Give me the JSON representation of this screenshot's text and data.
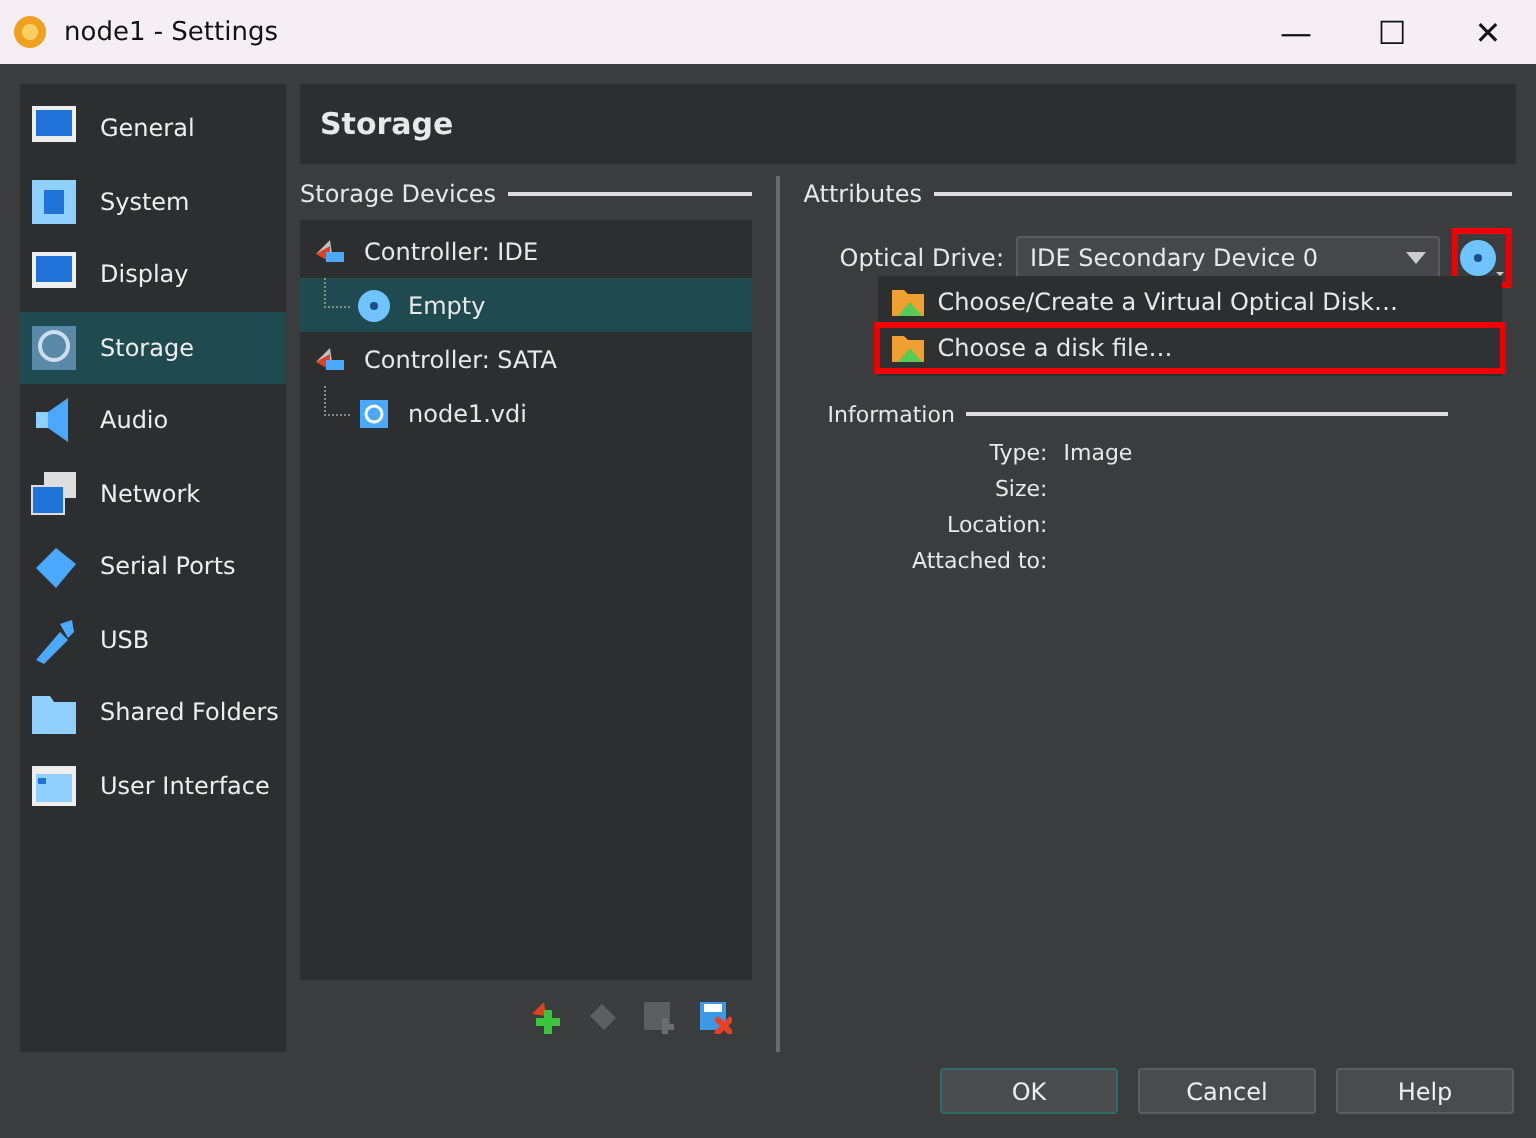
{
  "window": {
    "title": "node1 - Settings",
    "controls": [
      "—",
      "☐",
      "✕"
    ]
  },
  "sidebar": {
    "items": [
      {
        "label": "General",
        "selected": false
      },
      {
        "label": "System",
        "selected": false
      },
      {
        "label": "Display",
        "selected": false
      },
      {
        "label": "Storage",
        "selected": true
      },
      {
        "label": "Audio",
        "selected": false
      },
      {
        "label": "Network",
        "selected": false
      },
      {
        "label": "Serial Ports",
        "selected": false
      },
      {
        "label": "USB",
        "selected": false
      },
      {
        "label": "Shared Folders",
        "selected": false
      },
      {
        "label": "User Interface",
        "selected": false
      }
    ]
  },
  "page_title": "Storage",
  "storage_devices": {
    "title": "Storage Devices",
    "tree": [
      {
        "label": "Controller: IDE",
        "kind": "controller",
        "selected": false,
        "children": [
          {
            "label": "Empty",
            "kind": "optical",
            "selected": true
          }
        ]
      },
      {
        "label": "Controller: SATA",
        "kind": "controller",
        "selected": false,
        "children": [
          {
            "label": "node1.vdi",
            "kind": "harddisk",
            "selected": false
          }
        ]
      }
    ],
    "toolbar": [
      {
        "disabled": false
      },
      {
        "disabled": true
      },
      {
        "disabled": true
      },
      {
        "disabled": false
      }
    ]
  },
  "attributes": {
    "title": "Attributes",
    "optical_drive": {
      "label": "Optical Drive:",
      "value": "IDE Secondary Device 0"
    },
    "disk_button": {
      "highlighted": true
    },
    "menu": [
      {
        "label": "Choose/Create a Virtual Optical Disk…",
        "highlighted": false
      },
      {
        "label": "Choose a disk file…",
        "highlighted": true
      }
    ]
  },
  "information": {
    "title": "Information",
    "rows": [
      {
        "label": "Type:",
        "value": "Image"
      },
      {
        "label": "Size:"
      },
      {
        "label": "Location:"
      },
      {
        "label": "Attached to:"
      }
    ]
  },
  "buttons": [
    {
      "label": "OK",
      "default": true
    },
    {
      "label": "Cancel",
      "default": false
    },
    {
      "label": "Help",
      "default": false
    }
  ]
}
